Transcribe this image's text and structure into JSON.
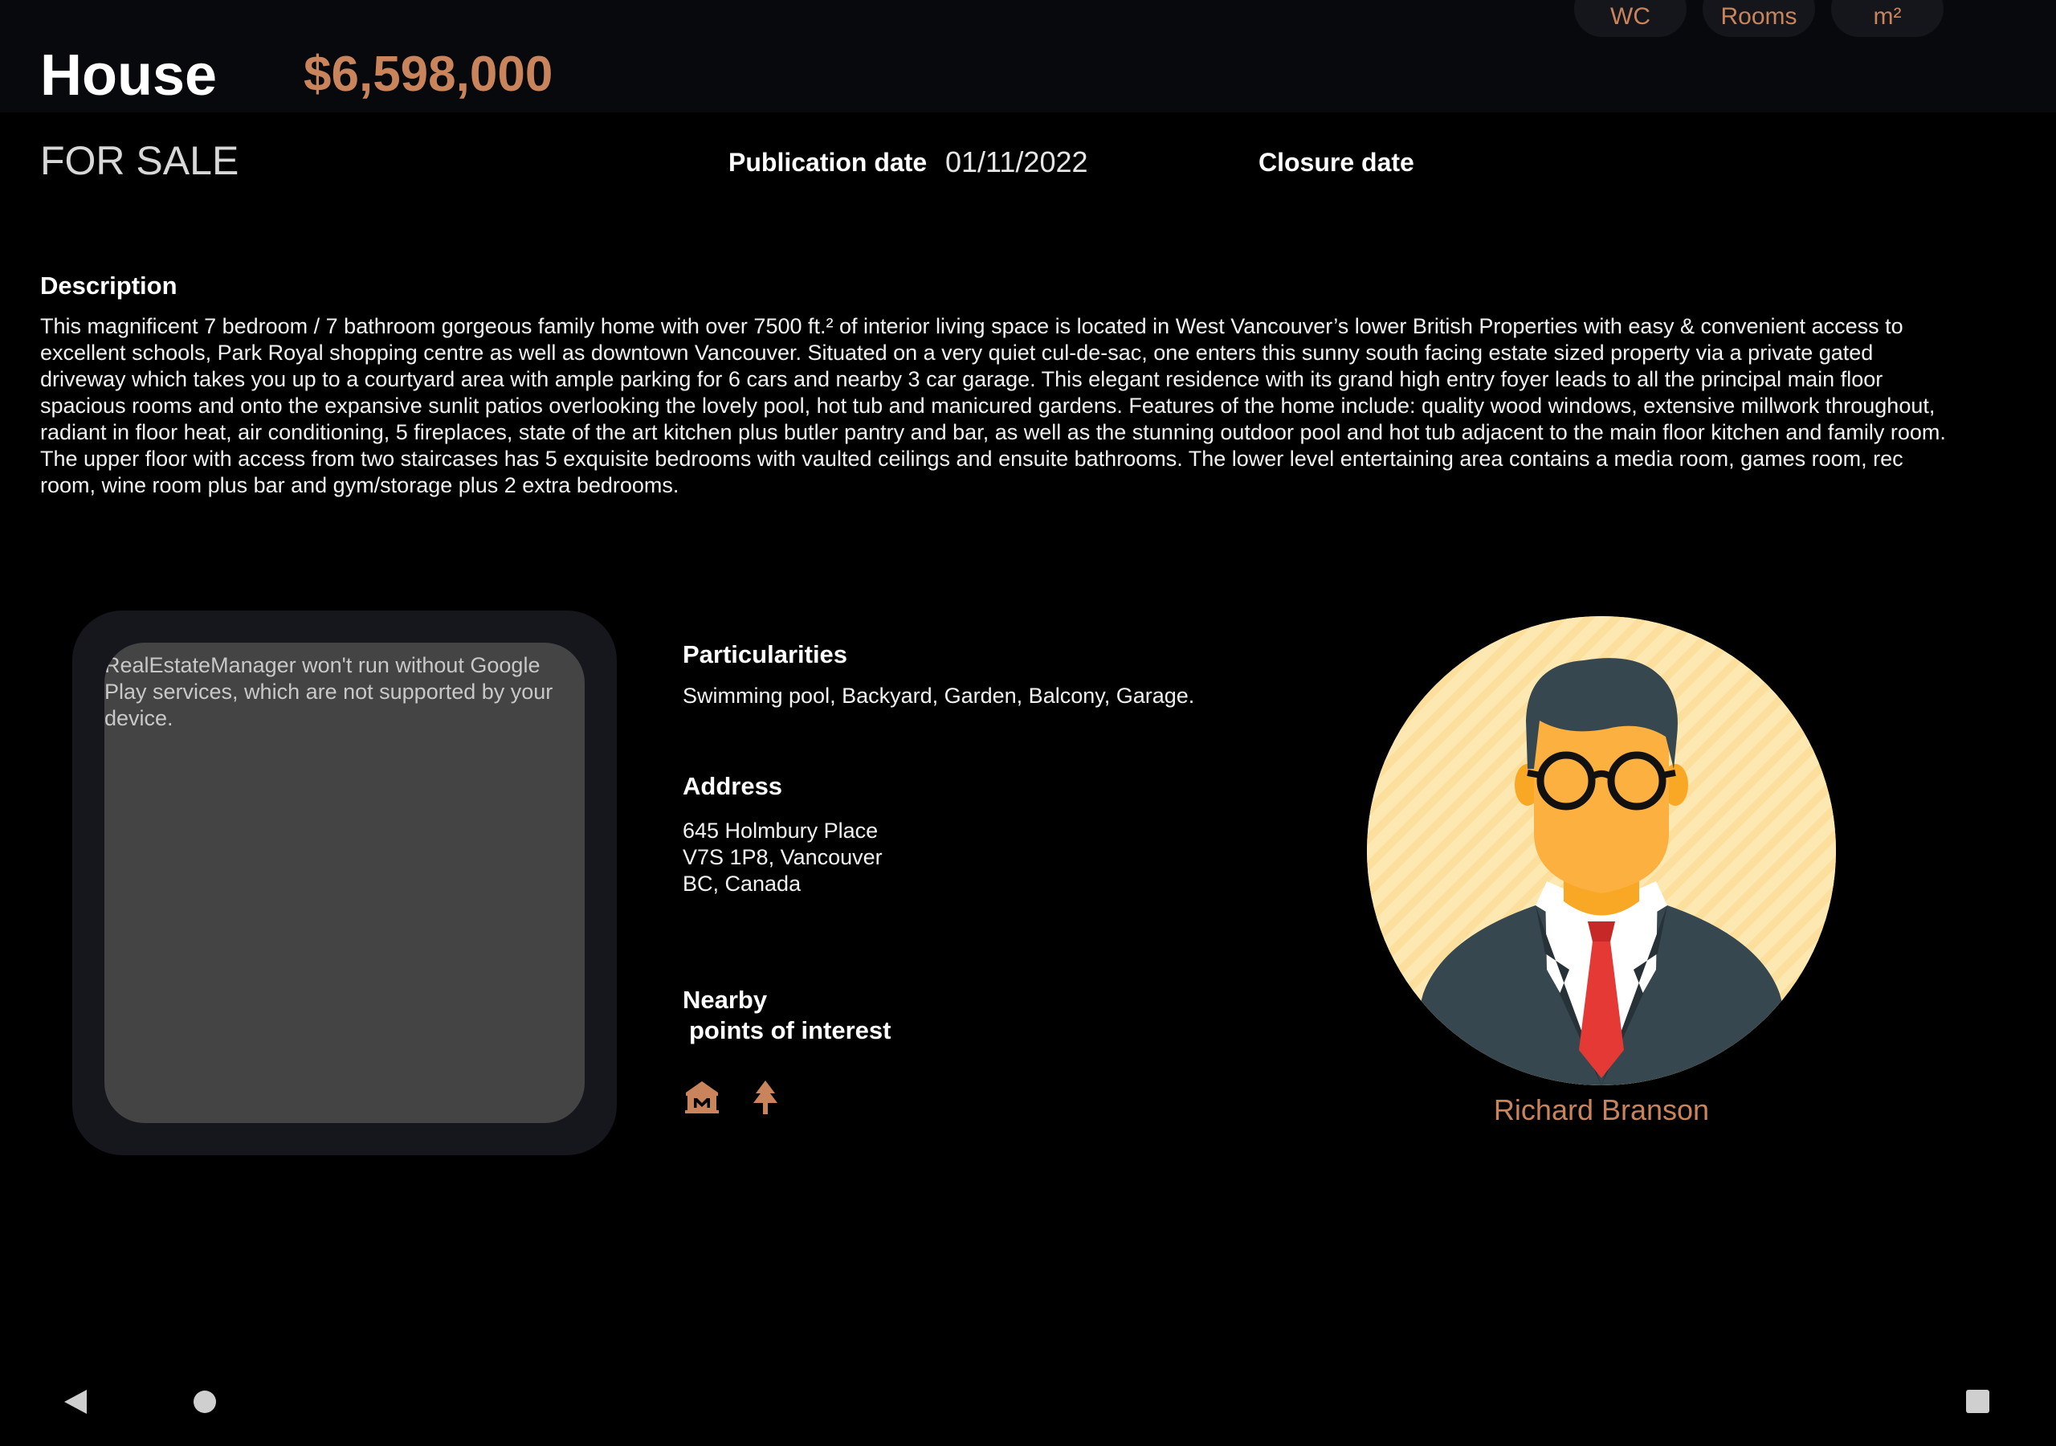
{
  "header": {
    "chips": {
      "wc": "WC",
      "rooms": "Rooms",
      "area": "m²"
    },
    "property_type": "House",
    "price": "$6,598,000",
    "status": "FOR SALE",
    "publication_label": "Publication date",
    "publication_value": "01/11/2022",
    "closure_label": "Closure date"
  },
  "description": {
    "heading": "Description",
    "body": "This magnificent 7 bedroom / 7 bathroom gorgeous family home with over 7500 ft.² of interior living space is located in West Vancouver’s lower British Properties with easy & convenient access to excellent schools, Park Royal shopping centre as well as downtown Vancouver. Situated on a very quiet cul-de-sac, one enters this sunny south facing estate sized property via a private gated driveway which takes you up to a courtyard area with ample parking for 6 cars and nearby 3 car garage. This elegant residence with its grand high entry foyer leads to all the principal main floor spacious rooms and onto the expansive sunlit patios overlooking the lovely pool, hot tub and manicured gardens. Features of the home include: quality wood windows, extensive millwork throughout, radiant in floor heat, air conditioning, 5 fireplaces, state of the art kitchen plus butler pantry and bar, as well as the stunning outdoor pool and hot tub adjacent to the main floor kitchen and family room. The upper floor with access from two staircases has 5 exquisite bedrooms with vaulted ceilings and ensuite bathrooms. The lower level entertaining area contains a media room, games room, rec room, wine room plus bar and gym/storage plus 2 extra bedrooms."
  },
  "map": {
    "message": "RealEstateManager won't run without Google Play services, which are not supported by your device."
  },
  "particularities": {
    "heading": "Particularities",
    "text": "Swimming pool, Backyard, Garden, Balcony, Garage."
  },
  "address": {
    "heading": "Address",
    "lines": [
      "645 Holmbury Place",
      "V7S 1P8, Vancouver",
      "BC, Canada"
    ]
  },
  "nearby": {
    "heading_lines": [
      "Nearby",
      "points of interest"
    ],
    "icons": [
      "museum-icon",
      "park-tree-icon"
    ]
  },
  "agent": {
    "name": "Richard Branson",
    "avatar_icon": "businessman-avatar-icon"
  },
  "navbar": {
    "icons": [
      "back-icon",
      "home-icon",
      "recents-icon"
    ]
  },
  "colors": {
    "accent": "#c9845c",
    "background": "#000000",
    "card": "#15171c",
    "map_placeholder": "#444444",
    "avatar_bg": "#fde8b1"
  }
}
